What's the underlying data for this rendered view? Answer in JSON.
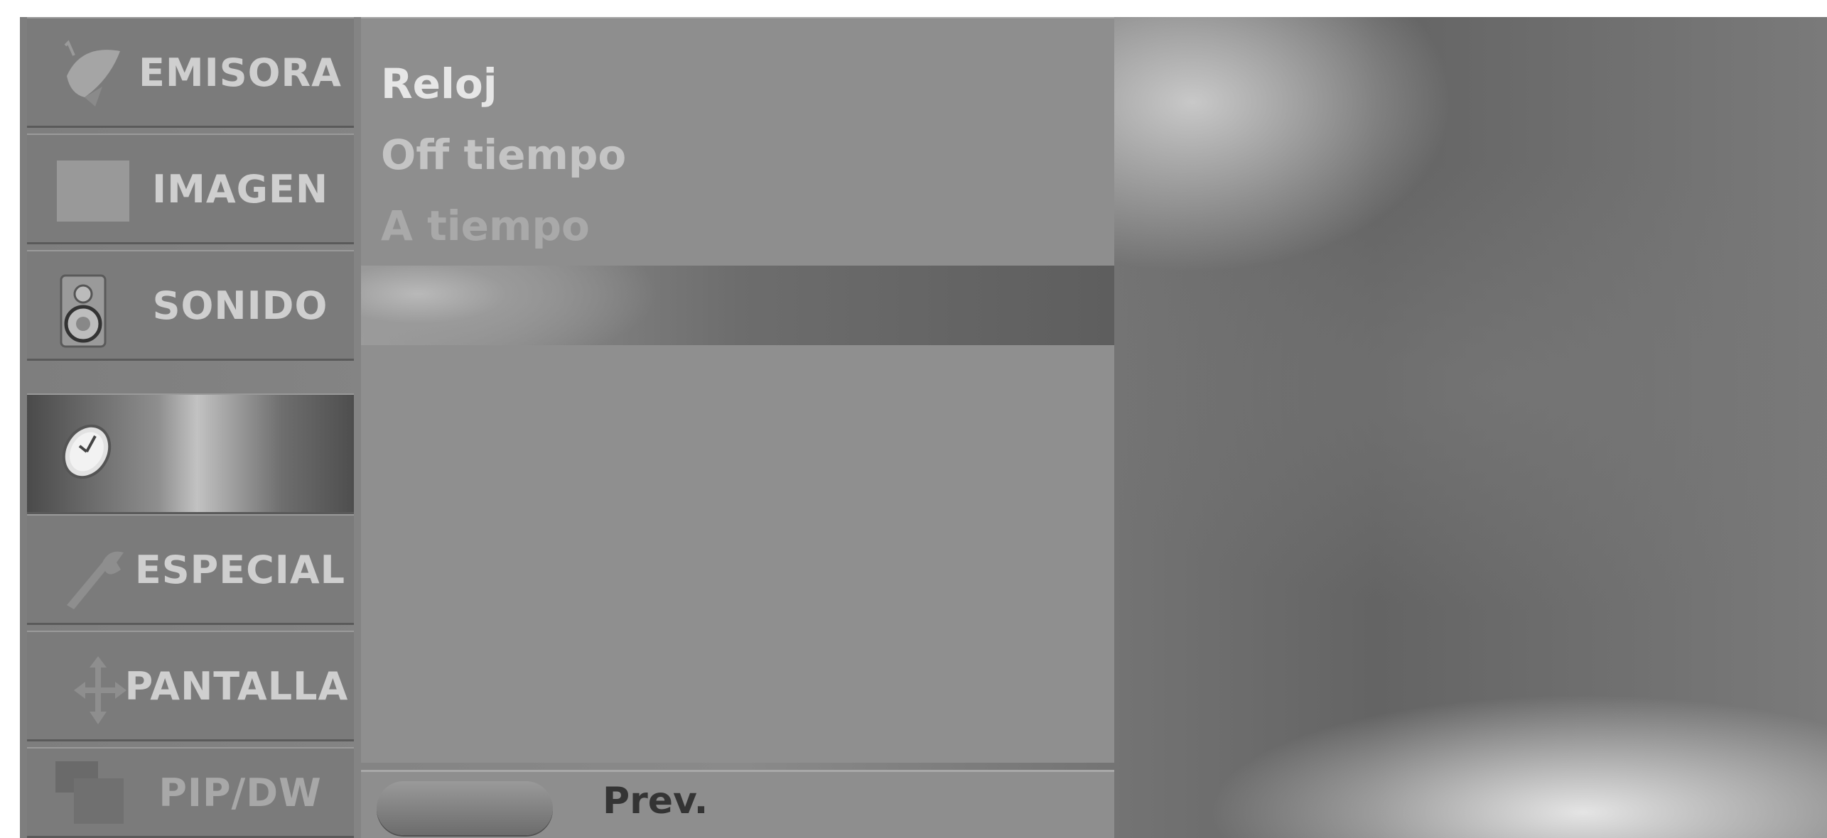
{
  "sidebar": {
    "items": [
      {
        "label": "EMISORA",
        "icon": "satellite-dish-icon"
      },
      {
        "label": "IMAGEN",
        "icon": "picture-square-icon"
      },
      {
        "label": "SONIDO",
        "icon": "speaker-icon"
      },
      {
        "label": "",
        "icon": "clock-icon",
        "active": true
      },
      {
        "label": "ESPECIAL",
        "icon": "wrench-icon"
      },
      {
        "label": "PANTALLA",
        "icon": "arrows-icon"
      },
      {
        "label": "PIP/DW",
        "icon": "pip-windows-icon"
      }
    ]
  },
  "menu": {
    "items": [
      "Reloj",
      "Off tiempo",
      "A tiempo"
    ]
  },
  "footer": {
    "prev_label": "Prev."
  },
  "colors": {
    "panel": "#8e8e8e",
    "sidebar_item": "#7b7b7b",
    "text_light": "#dedede",
    "text_dark": "#343434"
  }
}
